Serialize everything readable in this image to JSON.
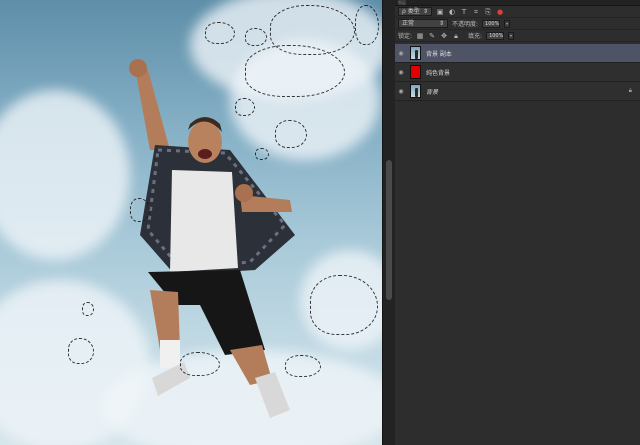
{
  "panel": {
    "tab_label": "图层",
    "filter": {
      "kind_label": "ρ 类型",
      "icons": [
        "image-filter-icon",
        "adjustment-filter-icon",
        "type-filter-icon",
        "shape-filter-icon",
        "smart-object-filter-icon",
        "filter-toggle-icon"
      ]
    },
    "blend_mode": "正常",
    "opacity_label": "不透明度:",
    "opacity_value": "100%",
    "lock_label": "锁定:",
    "fill_label": "填充:",
    "fill_value": "100%"
  },
  "layers": [
    {
      "name": "背景 副本",
      "thumb": "photo",
      "active": true
    },
    {
      "name": "纯色背景",
      "thumb": "red",
      "active": false
    },
    {
      "name": "背景",
      "thumb": "photo",
      "active": false,
      "italic": true,
      "locked": true
    }
  ],
  "colors": {
    "panel_bg": "#2d2d2d",
    "active_layer": "#4e5465",
    "fill_layer": "#e00000"
  }
}
